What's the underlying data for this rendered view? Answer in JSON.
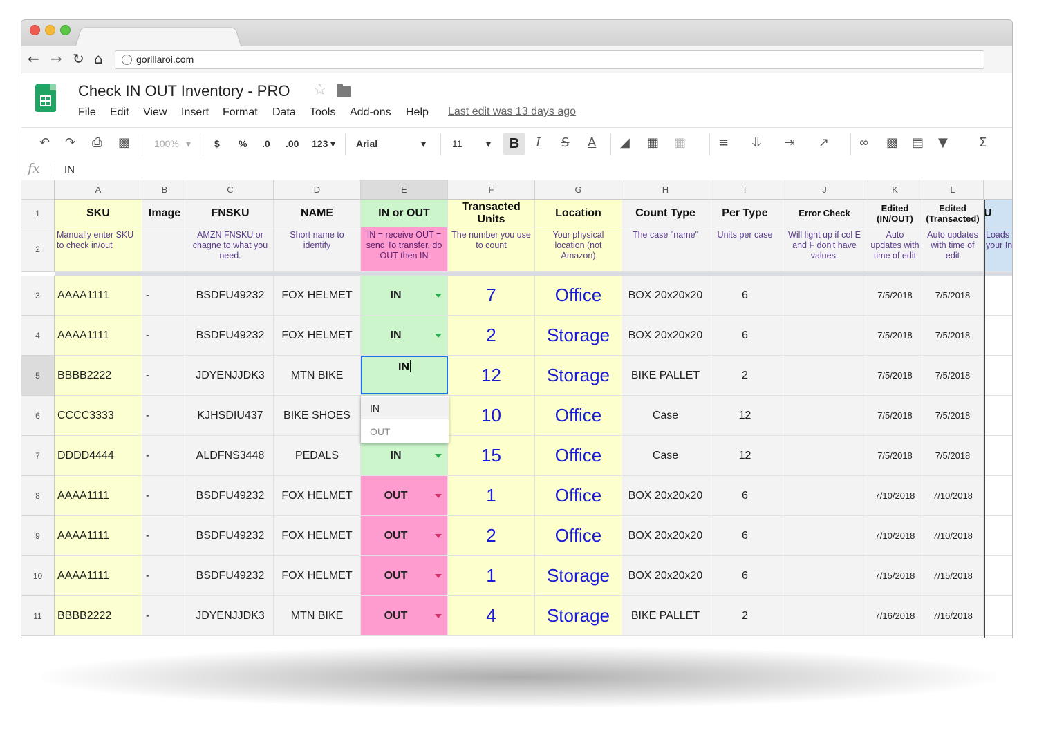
{
  "browser": {
    "url": "gorillaroi.com"
  },
  "app": {
    "title": "Check IN OUT Inventory - PRO",
    "menu": [
      "File",
      "Edit",
      "View",
      "Insert",
      "Format",
      "Data",
      "Tools",
      "Add-ons",
      "Help"
    ],
    "last_edit": "Last edit was 13 days ago"
  },
  "toolbar": {
    "zoom": "100%",
    "currency": "$",
    "percent": "%",
    "dec_less": ".0",
    "dec_more": ".00",
    "num_format": "123",
    "font": "Arial",
    "font_size": "11",
    "bold": "B",
    "italic": "I",
    "strike": "S",
    "text_color_letter": "A"
  },
  "formula_bar": {
    "label": "fx",
    "value": "IN"
  },
  "columns": [
    "A",
    "B",
    "C",
    "D",
    "E",
    "F",
    "G",
    "H",
    "I",
    "J",
    "K",
    "L"
  ],
  "header_row1": [
    "SKU",
    "Image",
    "FNSKU",
    "NAME",
    "IN or OUT",
    "Transacted Units",
    "Location",
    "Count Type",
    "Per Type",
    "Error Check",
    "Edited (IN/OUT)",
    "Edited (Transacted)",
    "U"
  ],
  "header_row2": [
    "Manually enter SKU to check in/out",
    "",
    "AMZN FNSKU or chagne to what you need.",
    "Short name to identify",
    "IN = receive OUT = send To transfer, do OUT then IN",
    "The number you use to count",
    "Your physical location (not Amazon)",
    "The case \"name\"",
    "Units per case",
    "Will light up if col E and F don't have values.",
    "Auto updates with time of edit",
    "Auto updates with time of edit",
    "Loads your Inve"
  ],
  "rows": [
    {
      "num": "3",
      "sku": "AAAA1111",
      "image": "-",
      "fnsku": "BSDFU49232",
      "name": "FOX HELMET",
      "io": "IN",
      "units": "7",
      "location": "Office",
      "count_type": "BOX 20x20x20",
      "per_type": "6",
      "error": "",
      "edited_io": "7/5/2018",
      "edited_tx": "7/5/2018"
    },
    {
      "num": "4",
      "sku": "AAAA1111",
      "image": "-",
      "fnsku": "BSDFU49232",
      "name": "FOX HELMET",
      "io": "IN",
      "units": "2",
      "location": "Storage",
      "count_type": "BOX 20x20x20",
      "per_type": "6",
      "error": "",
      "edited_io": "7/5/2018",
      "edited_tx": "7/5/2018"
    },
    {
      "num": "5",
      "sku": "BBBB2222",
      "image": "-",
      "fnsku": "JDYENJJDK3",
      "name": "MTN BIKE",
      "io": "IN",
      "units": "12",
      "location": "Storage",
      "count_type": "BIKE PALLET",
      "per_type": "2",
      "error": "",
      "edited_io": "7/5/2018",
      "edited_tx": "7/5/2018"
    },
    {
      "num": "6",
      "sku": "CCCC3333",
      "image": "-",
      "fnsku": "KJHSDIU437",
      "name": "BIKE SHOES",
      "io": "",
      "units": "10",
      "location": "Office",
      "count_type": "Case",
      "per_type": "12",
      "error": "",
      "edited_io": "7/5/2018",
      "edited_tx": "7/5/2018"
    },
    {
      "num": "7",
      "sku": "DDDD4444",
      "image": "-",
      "fnsku": "ALDFNS3448",
      "name": "PEDALS",
      "io": "IN",
      "units": "15",
      "location": "Office",
      "count_type": "Case",
      "per_type": "12",
      "error": "",
      "edited_io": "7/5/2018",
      "edited_tx": "7/5/2018"
    },
    {
      "num": "8",
      "sku": "AAAA1111",
      "image": "-",
      "fnsku": "BSDFU49232",
      "name": "FOX HELMET",
      "io": "OUT",
      "units": "1",
      "location": "Office",
      "count_type": "BOX 20x20x20",
      "per_type": "6",
      "error": "",
      "edited_io": "7/10/2018",
      "edited_tx": "7/10/2018"
    },
    {
      "num": "9",
      "sku": "AAAA1111",
      "image": "-",
      "fnsku": "BSDFU49232",
      "name": "FOX HELMET",
      "io": "OUT",
      "units": "2",
      "location": "Office",
      "count_type": "BOX 20x20x20",
      "per_type": "6",
      "error": "",
      "edited_io": "7/10/2018",
      "edited_tx": "7/10/2018"
    },
    {
      "num": "10",
      "sku": "AAAA1111",
      "image": "-",
      "fnsku": "BSDFU49232",
      "name": "FOX HELMET",
      "io": "OUT",
      "units": "1",
      "location": "Storage",
      "count_type": "BOX 20x20x20",
      "per_type": "6",
      "error": "",
      "edited_io": "7/15/2018",
      "edited_tx": "7/15/2018"
    },
    {
      "num": "11",
      "sku": "BBBB2222",
      "image": "-",
      "fnsku": "JDYENJJDK3",
      "name": "MTN BIKE",
      "io": "OUT",
      "units": "4",
      "location": "Storage",
      "count_type": "BIKE PALLET",
      "per_type": "2",
      "error": "",
      "edited_io": "7/16/2018",
      "edited_tx": "7/16/2018"
    }
  ],
  "editing_cell": {
    "value": "IN"
  },
  "dropdown_options": [
    "IN",
    "OUT"
  ],
  "colors": {
    "sku_fill": "#fcffcf",
    "in_fill": "#ccf5cc",
    "out_fill": "#ff9ccf",
    "units_fill": "#fdffcc",
    "location_fill": "#fdffcc",
    "accent_blue": "#1a1ad9"
  }
}
